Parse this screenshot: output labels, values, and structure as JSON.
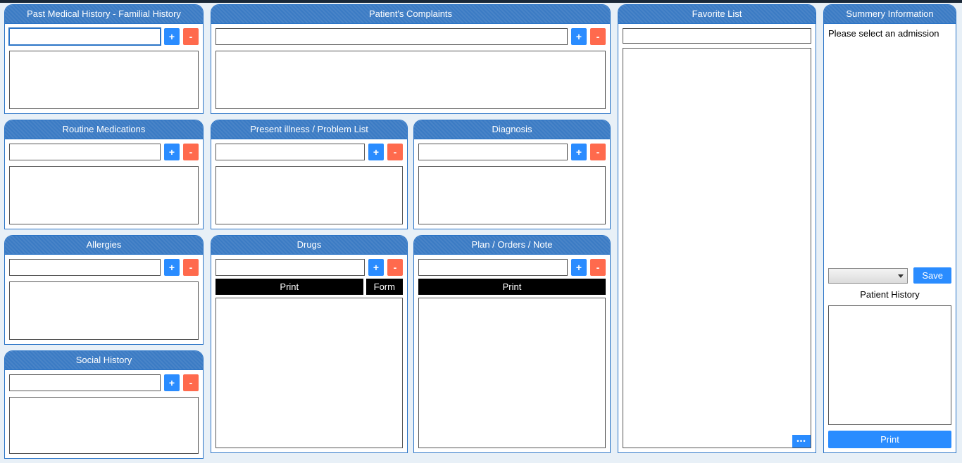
{
  "buttons": {
    "add": "+",
    "del": "-",
    "print": "Print",
    "form": "Form",
    "save": "Save",
    "more": "•••"
  },
  "panels": {
    "pmh": {
      "title": "Past Medical History - Familial History"
    },
    "routine": {
      "title": "Routine Medications"
    },
    "allergies": {
      "title": "Allergies"
    },
    "social": {
      "title": "Social History"
    },
    "complaints": {
      "title": "Patient's Complaints"
    },
    "present": {
      "title": "Present illness / Problem List"
    },
    "diagnosis": {
      "title": "Diagnosis"
    },
    "drugs": {
      "title": "Drugs"
    },
    "plan": {
      "title": "Plan / Orders / Note"
    },
    "favorite": {
      "title": "Favorite List"
    },
    "summary": {
      "title": "Summery Information",
      "message": "Please select an admission",
      "patient_history_label": "Patient History"
    }
  }
}
